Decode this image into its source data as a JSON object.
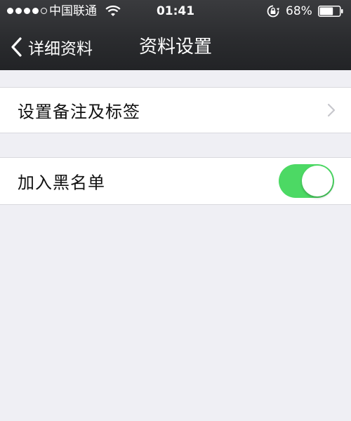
{
  "status_bar": {
    "carrier": "中国联通",
    "time": "01:41",
    "battery_percent": "68%",
    "battery_level": 0.68,
    "signal_bars_filled": 4,
    "signal_bars_total": 5,
    "icons": [
      "wifi-icon",
      "orientation-lock-icon",
      "battery-icon"
    ]
  },
  "nav": {
    "back_label": "详细资料",
    "title": "资料设置"
  },
  "settings": {
    "remark_label": "设置备注及标签",
    "blacklist_label": "加入黑名单",
    "blacklist_enabled": true
  },
  "colors": {
    "toggle_on": "#4cd964",
    "background": "#efeff4",
    "nav_background": "#2b2c2f"
  }
}
